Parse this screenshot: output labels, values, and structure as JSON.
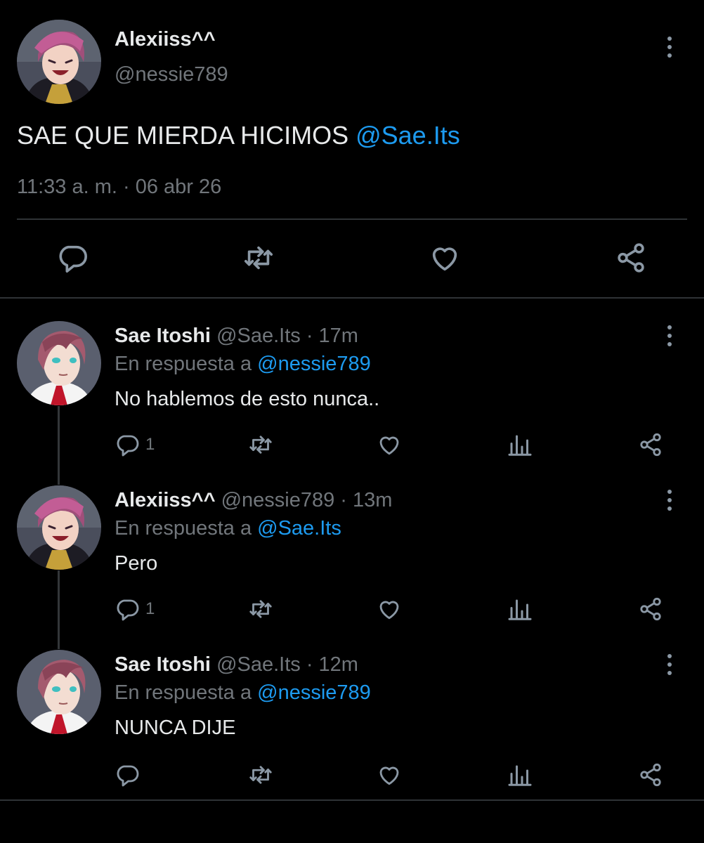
{
  "main_tweet": {
    "display_name": "Alexiiss^^",
    "handle": "@nessie789",
    "text_before": "SAE QUE MIERDA HICIMOS ",
    "mention": "@Sae.Its",
    "text_after": "",
    "timestamp": "11:33 a. m. · 06 abr 26"
  },
  "replies": [
    {
      "display_name": "Sae Itoshi",
      "meta": "@Sae.Its · 17m",
      "in_reply_prefix": "En respuesta a ",
      "in_reply_to": "@nessie789",
      "text": "No hablemos de esto nunca..",
      "reply_count": "1"
    },
    {
      "display_name": "Alexiiss^^",
      "meta": "@nessie789 · 13m",
      "in_reply_prefix": "En respuesta a ",
      "in_reply_to": "@Sae.Its",
      "text": "Pero",
      "reply_count": "1"
    },
    {
      "display_name": "Sae Itoshi",
      "meta": "@Sae.Its · 12m",
      "in_reply_prefix": "En respuesta a ",
      "in_reply_to": "@nessie789",
      "text": "NUNCA DIJE",
      "reply_count": ""
    }
  ],
  "colors": {
    "background": "#000000",
    "text": "#e7e9ea",
    "muted": "#71767b",
    "link": "#1d9bf0",
    "icon": "#8b98a5"
  },
  "icons": [
    "reply-icon",
    "retweet-icon",
    "like-icon",
    "share-icon",
    "views-icon",
    "more-icon"
  ]
}
